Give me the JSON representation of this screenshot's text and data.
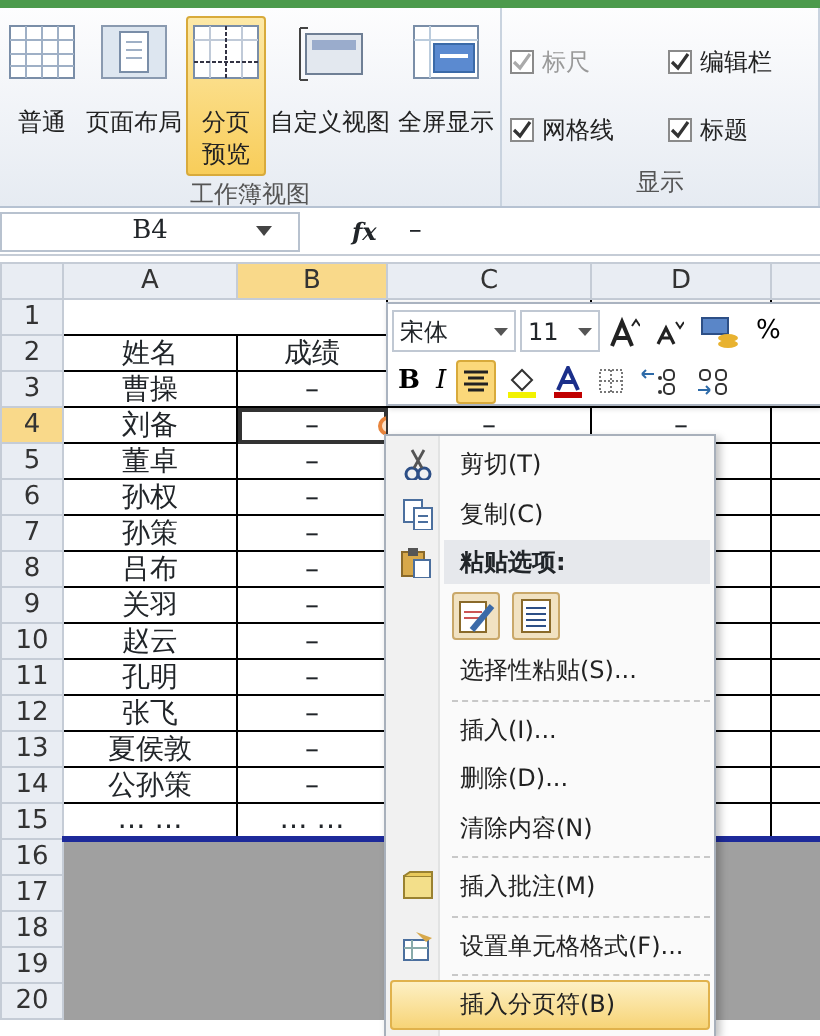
{
  "ribbon": {
    "groups": [
      {
        "label": "工作簿视图",
        "buttons": [
          {
            "label": "普通",
            "selected": false
          },
          {
            "label": "页面布局",
            "selected": false
          },
          {
            "label": "分页预览",
            "selected": true
          },
          {
            "label": "自定义视图",
            "selected": false
          },
          {
            "label": "全屏显示",
            "selected": false
          }
        ]
      },
      {
        "label": "显示",
        "checkboxes": [
          {
            "label": "标尺",
            "checked": true,
            "disabled": true
          },
          {
            "label": "编辑栏",
            "checked": true,
            "disabled": false
          },
          {
            "label": "网格线",
            "checked": true,
            "disabled": false
          },
          {
            "label": "标题",
            "checked": true,
            "disabled": false
          }
        ]
      }
    ]
  },
  "formula_bar": {
    "name_box": "B4",
    "fx": "fx",
    "value": "–"
  },
  "sheet": {
    "columns": [
      {
        "label": "A",
        "selected": false
      },
      {
        "label": "B",
        "selected": true
      },
      {
        "label": "C",
        "selected": false
      },
      {
        "label": "D",
        "selected": false
      }
    ],
    "rows": [
      {
        "number": "1",
        "selected": false,
        "in_print_area": true,
        "cells": []
      },
      {
        "number": "2",
        "selected": false,
        "in_print_area": true,
        "cells": [
          "姓名",
          "成绩"
        ]
      },
      {
        "number": "3",
        "selected": false,
        "in_print_area": true,
        "cells": [
          "曹操",
          "–"
        ]
      },
      {
        "number": "4",
        "selected": true,
        "in_print_area": true,
        "cells": [
          "刘备",
          "–",
          "–",
          "–"
        ]
      },
      {
        "number": "5",
        "selected": false,
        "in_print_area": true,
        "cells": [
          "董卓",
          "–"
        ]
      },
      {
        "number": "6",
        "selected": false,
        "in_print_area": true,
        "cells": [
          "孙权",
          "–"
        ]
      },
      {
        "number": "7",
        "selected": false,
        "in_print_area": true,
        "cells": [
          "孙策",
          "–"
        ]
      },
      {
        "number": "8",
        "selected": false,
        "in_print_area": true,
        "cells": [
          "吕布",
          "–"
        ]
      },
      {
        "number": "9",
        "selected": false,
        "in_print_area": true,
        "cells": [
          "关羽",
          "–"
        ]
      },
      {
        "number": "10",
        "selected": false,
        "in_print_area": true,
        "cells": [
          "赵云",
          "–"
        ]
      },
      {
        "number": "11",
        "selected": false,
        "in_print_area": true,
        "cells": [
          "孔明",
          "–"
        ]
      },
      {
        "number": "12",
        "selected": false,
        "in_print_area": true,
        "cells": [
          "张飞",
          "–"
        ]
      },
      {
        "number": "13",
        "selected": false,
        "in_print_area": true,
        "cells": [
          "夏侯敦",
          "–"
        ]
      },
      {
        "number": "14",
        "selected": false,
        "in_print_area": true,
        "cells": [
          "公孙策",
          "–"
        ]
      },
      {
        "number": "15",
        "selected": false,
        "in_print_area": true,
        "cells": [
          "… …",
          "… …"
        ]
      },
      {
        "number": "16",
        "selected": false,
        "in_print_area": false,
        "cells": []
      },
      {
        "number": "17",
        "selected": false,
        "in_print_area": false,
        "cells": []
      },
      {
        "number": "18",
        "selected": false,
        "in_print_area": false,
        "cells": []
      },
      {
        "number": "19",
        "selected": false,
        "in_print_area": false,
        "cells": []
      },
      {
        "number": "20",
        "selected": false,
        "in_print_area": false,
        "cells": []
      }
    ]
  },
  "mini_toolbar": {
    "font": "宋体",
    "size": "11",
    "percent": "%",
    "bold": "B",
    "italic": "I",
    "align_selected": true
  },
  "context_menu": [
    {
      "kind": "item",
      "label": "剪切(T)",
      "selected": false
    },
    {
      "kind": "item",
      "label": "复制(C)",
      "selected": false
    },
    {
      "kind": "header",
      "label": "粘贴选项:"
    },
    {
      "kind": "paste-icons"
    },
    {
      "kind": "item",
      "label": "选择性粘贴(S)...",
      "selected": false
    },
    {
      "kind": "separator"
    },
    {
      "kind": "item",
      "label": "插入(I)...",
      "selected": false
    },
    {
      "kind": "item",
      "label": "删除(D)...",
      "selected": false
    },
    {
      "kind": "item",
      "label": "清除内容(N)",
      "selected": false
    },
    {
      "kind": "separator"
    },
    {
      "kind": "item",
      "label": "插入批注(M)",
      "selected": false
    },
    {
      "kind": "separator"
    },
    {
      "kind": "item",
      "label": "设置单元格格式(F)...",
      "selected": false
    },
    {
      "kind": "separator"
    },
    {
      "kind": "item",
      "label": "插入分页符(B)",
      "selected": true
    }
  ]
}
